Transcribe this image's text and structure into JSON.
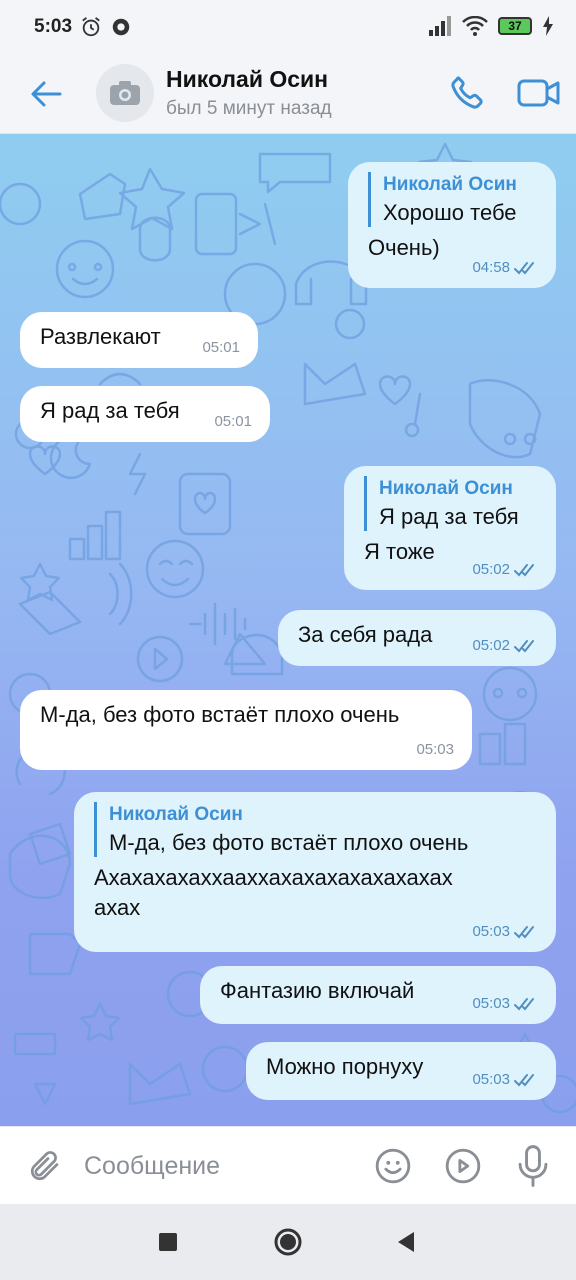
{
  "status_bar": {
    "time": "5:03",
    "battery": "37",
    "icons": [
      "alarm-icon",
      "sync-icon",
      "signal-icon",
      "wifi-icon",
      "battery-icon",
      "charging-icon"
    ]
  },
  "header": {
    "contact_name": "Николай Осин",
    "contact_status": "был 5 минут назад",
    "icons": [
      "back-arrow-icon",
      "camera-avatar-icon",
      "phone-icon",
      "video-call-icon"
    ]
  },
  "messages": [
    {
      "dir": "out",
      "reply_name": "Николай Осин",
      "reply_text": "Хорошо тебе",
      "text": "Очень)",
      "time": "04:58"
    },
    {
      "dir": "in",
      "text": "Развлекают",
      "time": "05:01"
    },
    {
      "dir": "in",
      "text": "Я рад за тебя",
      "time": "05:01"
    },
    {
      "dir": "out",
      "reply_name": "Николай Осин",
      "reply_text": "Я рад за тебя",
      "text": "Я тоже",
      "time": "05:02"
    },
    {
      "dir": "out",
      "text": "За себя рада",
      "time": "05:02"
    },
    {
      "dir": "in",
      "text": "М-да, без фото встаёт плохо очень",
      "time": "05:03"
    },
    {
      "dir": "out",
      "reply_name": "Николай Осин",
      "reply_text": "М-да, без фото встаёт плохо очень",
      "text_line1": "Ахахахахаххааххахахахахахахахах",
      "text_line2": "ахах",
      "time": "05:03"
    },
    {
      "dir": "out",
      "text": "Фантазию включай",
      "time": "05:03"
    },
    {
      "dir": "out",
      "text": "Можно порнуху",
      "time": "05:03"
    }
  ],
  "composer": {
    "placeholder": "Сообщение",
    "icons": [
      "paperclip-icon",
      "emoji-icon",
      "video-message-icon",
      "microphone-icon"
    ]
  },
  "colors": {
    "accent": "#3d8fd6",
    "outgoing_bubble": "#dff3fd",
    "incoming_bubble": "#ffffff",
    "chat_bg_top": "#8fcdf0",
    "chat_bg_bottom": "#8a9fee"
  }
}
